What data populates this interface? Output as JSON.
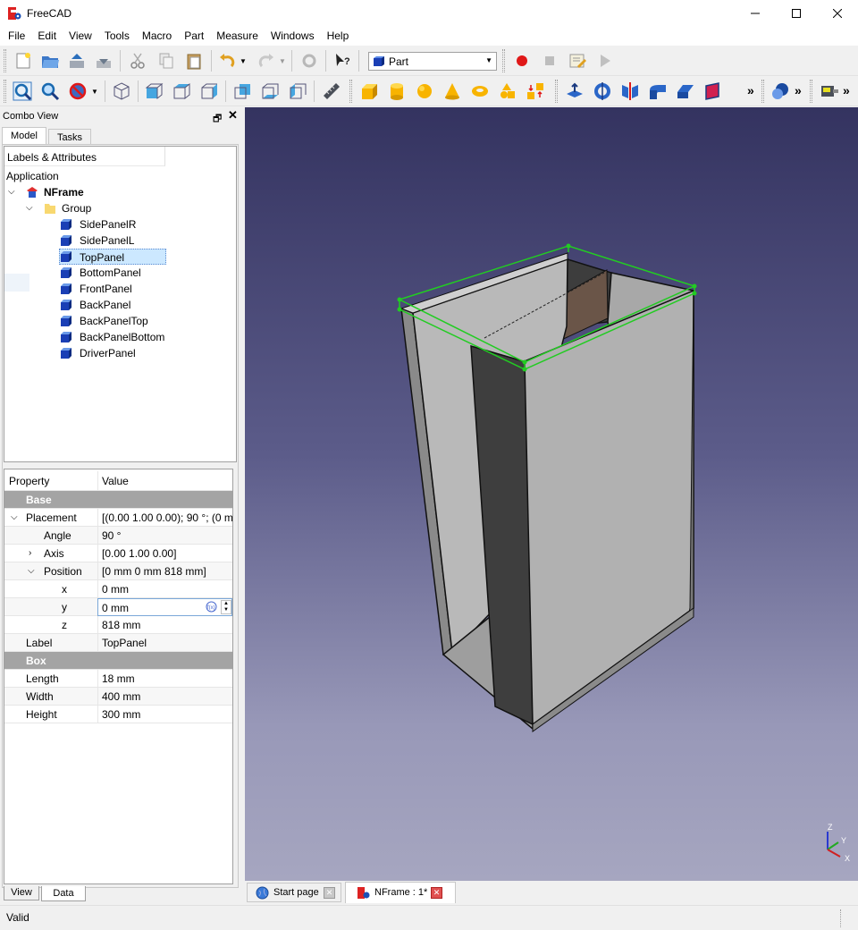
{
  "window": {
    "title": "FreeCAD"
  },
  "menu": [
    "File",
    "Edit",
    "View",
    "Tools",
    "Macro",
    "Part",
    "Measure",
    "Windows",
    "Help"
  ],
  "toolbar": {
    "workbench": "Part",
    "overflow": "»"
  },
  "combo": {
    "title": "Combo View",
    "tabs": [
      "Model",
      "Tasks"
    ],
    "tree_header": "Labels & Attributes",
    "tree": {
      "root": "Application",
      "doc": "NFrame",
      "group": "Group",
      "items": [
        "SidePanelR",
        "SidePanelL",
        "TopPanel",
        "BottomPanel",
        "FrontPanel",
        "BackPanel",
        "BackPanelTop",
        "BackPanelBottom",
        "DriverPanel"
      ],
      "selected": "TopPanel"
    },
    "props": {
      "col_property": "Property",
      "col_value": "Value",
      "group_base": "Base",
      "placement_label": "Placement",
      "placement_value": "[(0.00 1.00 0.00); 90 °; (0 m...",
      "angle_label": "Angle",
      "angle_value": "90 °",
      "axis_label": "Axis",
      "axis_value": "[0.00 1.00 0.00]",
      "position_label": "Position",
      "position_value": "[0 mm  0 mm  818 mm]",
      "x_label": "x",
      "x_value": "0 mm",
      "y_label": "y",
      "y_value": "0 mm",
      "z_label": "z",
      "z_value": "818 mm",
      "label_label": "Label",
      "label_value": "TopPanel",
      "group_box": "Box",
      "length_label": "Length",
      "length_value": "18 mm",
      "width_label": "Width",
      "width_value": "400 mm",
      "height_label": "Height",
      "height_value": "300 mm"
    },
    "bottom_tabs": [
      "View",
      "Data"
    ]
  },
  "doc_tabs": [
    {
      "label": "Start page"
    },
    {
      "label": "NFrame : 1*"
    }
  ],
  "axis": {
    "z": "Z",
    "y": "Y",
    "x": "X"
  },
  "status": "Valid"
}
